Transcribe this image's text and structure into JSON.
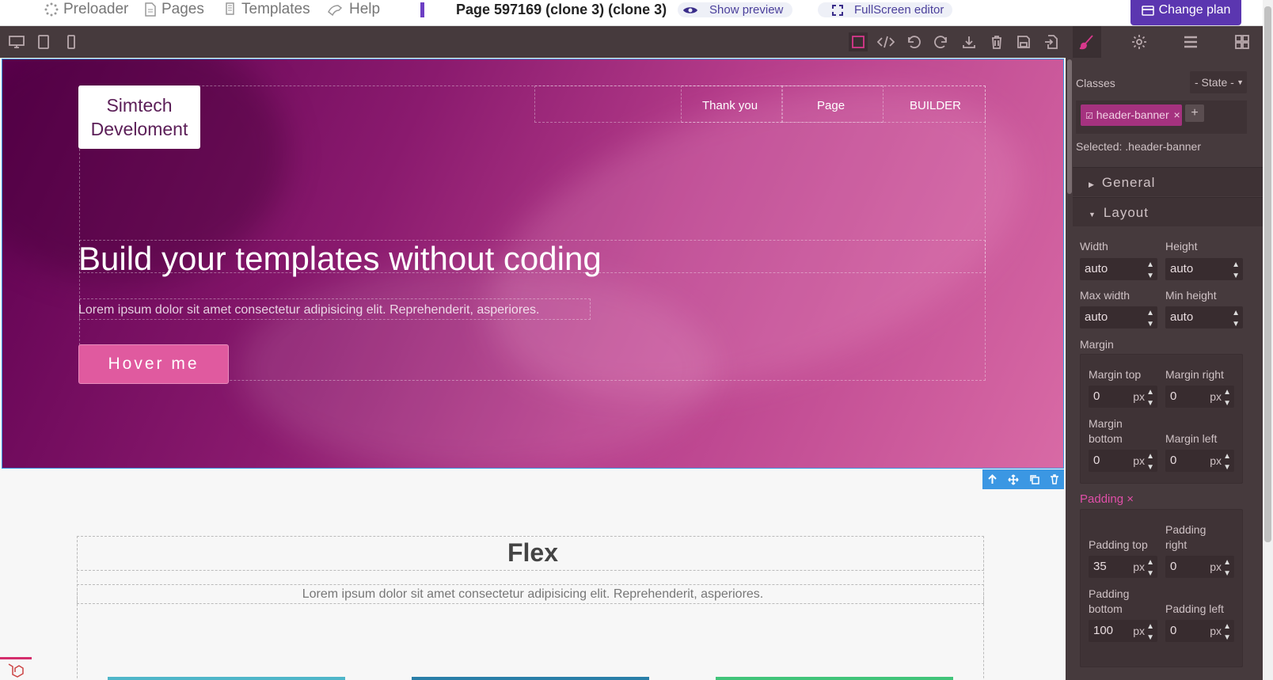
{
  "topbar": {
    "nav": [
      {
        "label": "Preloader",
        "icon": "spinner-icon"
      },
      {
        "label": "Pages",
        "icon": "page-icon"
      },
      {
        "label": "Templates",
        "icon": "templates-icon"
      },
      {
        "label": "Help",
        "icon": "help-icon"
      }
    ],
    "page_title": "Page 597169 (clone 3) (clone 3)",
    "show_preview": "Show preview",
    "fullscreen": "FullScreen editor",
    "change_plan": "Change plan"
  },
  "toolbar": {
    "devices": [
      "desktop-icon",
      "tablet-icon",
      "mobile-icon"
    ],
    "actions": [
      "outline-icon",
      "code-icon",
      "undo-icon",
      "redo-icon",
      "download-icon",
      "trash-icon",
      "save-icon",
      "import-icon"
    ],
    "panels": [
      "brush-icon",
      "gear-icon",
      "layers-icon",
      "blocks-icon"
    ]
  },
  "hero": {
    "logo_line1": "Simtech",
    "logo_line2": "Develoment",
    "nav": [
      "Thank you",
      "Page",
      "BUILDER"
    ],
    "title": "Build your templates without coding",
    "subtitle": "Lorem ipsum dolor sit amet consectetur adipisicing elit. Reprehenderit, asperiores.",
    "button": "Hover me"
  },
  "flex_section": {
    "title": "Flex",
    "subtitle": "Lorem ipsum dolor sit amet consectetur adipisicing elit. Reprehenderit, asperiores."
  },
  "panel": {
    "classes_label": "Classes",
    "state": "- State -",
    "class_tag": "header-banner",
    "selected": "Selected: .header-banner",
    "general": "General",
    "layout": "Layout",
    "width_label": "Width",
    "width": "auto",
    "height_label": "Height",
    "height": "auto",
    "maxwidth_label": "Max width",
    "maxwidth": "auto",
    "minheight_label": "Min height",
    "minheight": "auto",
    "margin_label": "Margin",
    "margin_top_label": "Margin top",
    "margin_top": "0",
    "margin_right_label": "Margin right",
    "margin_right": "0",
    "margin_bottom_label_1": "Margin",
    "margin_bottom_label_2": "bottom",
    "margin_bottom": "0",
    "margin_left_label": "Margin left",
    "margin_left": "0",
    "padding_label": "Padding",
    "padding_top_label": "Padding top",
    "padding_top": "35",
    "padding_right_label_1": "Padding",
    "padding_right_label_2": "right",
    "padding_right": "0",
    "padding_bottom_label_1": "Padding",
    "padding_bottom_label_2": "bottom",
    "padding_bottom": "100",
    "padding_left_label": "Padding left",
    "padding_left": "0",
    "unit": "px"
  },
  "colors": {
    "accent": "#5b36b0",
    "panel": "#463a3d",
    "hero_pink": "#b53c8a",
    "button_pink": "#e05a9f",
    "selection": "#3b97e3",
    "padding_label": "#e04fa8"
  }
}
